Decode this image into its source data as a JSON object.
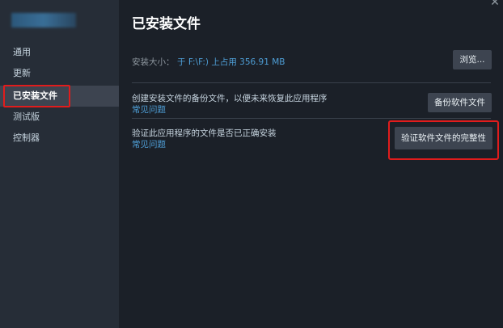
{
  "sidebar": {
    "items": [
      {
        "label": "通用"
      },
      {
        "label": "更新"
      },
      {
        "label": "已安装文件"
      },
      {
        "label": "测试版"
      },
      {
        "label": "控制器"
      }
    ]
  },
  "main": {
    "title": "已安装文件",
    "install_size": {
      "label": "安装大小：",
      "value": "于 F:\\F:) 上占用 356.91 MB",
      "browse_label": "浏览..."
    },
    "backup": {
      "text": "创建安装文件的备份文件，以便未来恢复此应用程序",
      "link": "常见问题",
      "button_label": "备份软件文件"
    },
    "verify": {
      "text": "验证此应用程序的文件是否已正确安装",
      "link": "常见问题",
      "button_label": "验证软件文件的完整性"
    }
  },
  "colors": {
    "sidebar_bg": "#262d37",
    "main_bg": "#1b2028",
    "accent_link": "#4e9ed6",
    "highlight": "#e11c1c"
  }
}
